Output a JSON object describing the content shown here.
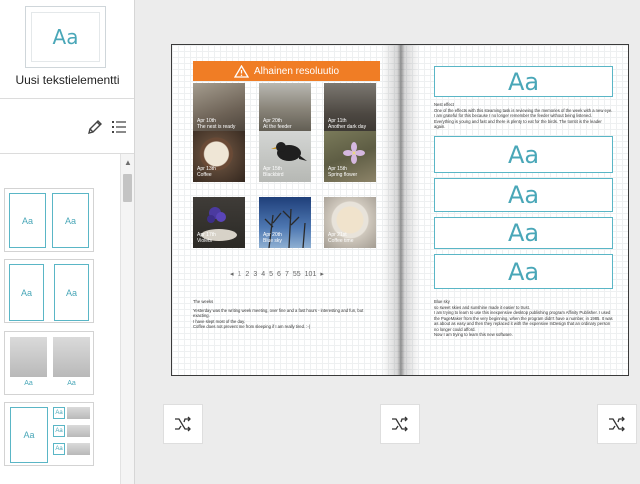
{
  "sidebar": {
    "text_element": {
      "glyph": "Aa",
      "label": "Uusi tekstielementti"
    },
    "icons": {
      "edit": "pencil-icon",
      "list": "list-icon"
    },
    "layouts": [
      {
        "kind": "two-text",
        "glyphs": [
          "Aa",
          "Aa"
        ]
      },
      {
        "kind": "two-text-tall",
        "glyphs": [
          "Aa",
          "Aa"
        ]
      },
      {
        "kind": "two-photo-captioned",
        "glyphs": [
          "Aa",
          "Aa"
        ]
      },
      {
        "kind": "text-and-grid",
        "glyphs": [
          "Aa",
          "Aa",
          "Aa",
          "Aa"
        ]
      }
    ]
  },
  "book": {
    "warning": "Alhainen resoluutio",
    "photos": [
      {
        "date": "Apr 10th",
        "title": "The nest is ready"
      },
      {
        "date": "Apr 20th",
        "title": "At the feeder"
      },
      {
        "date": "Apr 11th",
        "title": "Another dark day"
      },
      {
        "date": "Apr 13th",
        "title": "Coffee"
      },
      {
        "date": "Apr 15th",
        "title": "Blackbird"
      },
      {
        "date": "Apr 15th",
        "title": "Spring flower"
      },
      {
        "date": "Apr 17th",
        "title": "Violets"
      },
      {
        "date": "Apr 20th",
        "title": "Blue sky"
      },
      {
        "date": "Apr 21st",
        "title": "Coffee time"
      }
    ],
    "pager": {
      "prev": "◂",
      "pages": [
        "1",
        "2",
        "3",
        "4",
        "5",
        "6",
        "7",
        "55",
        "101"
      ],
      "next": "▸"
    },
    "left_text": {
      "title": "The weeks",
      "lines": [
        "Yesterday was the writing week meeting, over fine and a fast hours - interesting and fun, but exacting.",
        "I have slept most of the day.",
        "Coffee does not prevent me from sleeping if I am really tired. :-)"
      ]
    },
    "right_top_text": {
      "title": "Nest effect",
      "lines": [
        "One of the effects with this steaming task is reviewing the memories of the week with a new eye. I am grateful for this because I no longer remember the feeder without being listened.",
        "Everything is young and fast and there is plenty to eat for the birds. The tomtit is the leader again."
      ]
    },
    "right_bottom_text": {
      "title": "Blue sky",
      "lines": [
        "so sweet skies and sunshine made it easier to trust.",
        "I am trying to learn to use this inexpensive desktop publishing program Affinity Publisher. I used the PageMaker from the very beginning, when the program didn't have a number, in 1985. It was as about as easy and then they replaced it with the expensive InDesign that an ordinary person no longer could afford.",
        "Now I am trying to learn this new software."
      ]
    },
    "aa_boxes": [
      "Aa",
      "Aa",
      "Aa",
      "Aa",
      "Aa"
    ]
  },
  "footer": {
    "shuffle_icon": "shuffle-icon"
  }
}
